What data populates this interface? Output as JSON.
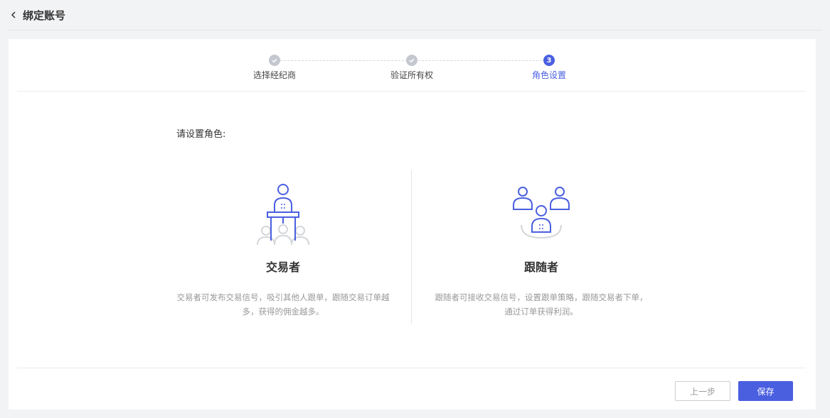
{
  "header": {
    "title": "绑定账号"
  },
  "steps": [
    {
      "label": "选择经纪商",
      "status": "done"
    },
    {
      "label": "验证所有权",
      "status": "done"
    },
    {
      "label": "角色设置",
      "status": "active",
      "number": "3"
    }
  ],
  "main": {
    "prompt": "请设置角色:",
    "roles": [
      {
        "name": "交易者",
        "desc": "交易者可发布交易信号，吸引其他人跟单，跟随交易订单越多，获得的佣金越多。"
      },
      {
        "name": "跟随者",
        "desc": "跟随者可接收交易信号，设置跟单策略，跟随交易者下单，通过订单获得利润。"
      }
    ]
  },
  "footer": {
    "prev_label": "上一步",
    "save_label": "保存"
  },
  "colors": {
    "accent": "#4a5fe0",
    "done": "#c4c8ce",
    "muted_icon": "#d4d6da"
  }
}
